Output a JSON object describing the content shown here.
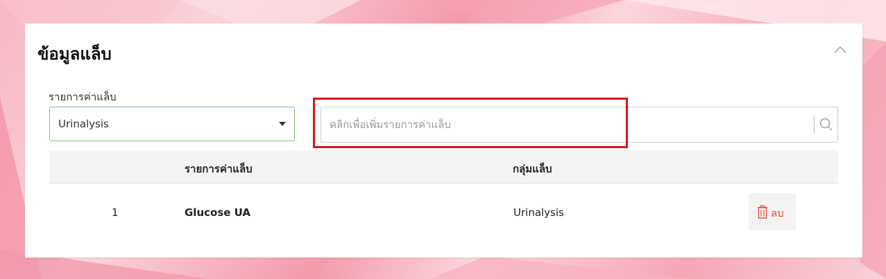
{
  "colors": {
    "accent_green": "#7dc57d",
    "highlight_red": "#e01212",
    "delete_red": "#e84c3d"
  },
  "card": {
    "title": "ข้อมูลแล็บ",
    "collapse_icon": "chevron-up-icon"
  },
  "filter": {
    "label": "รายการค่าแล็บ",
    "selected_value": "Urinalysis"
  },
  "search": {
    "placeholder": "คลิกเพื่อเพิ่มรายการค่าแล็บ",
    "value": "",
    "icon": "search-icon"
  },
  "table": {
    "headers": {
      "item": "รายการค่าแล็บ",
      "group": "กลุ่มแล็บ"
    },
    "rows": [
      {
        "index": "1",
        "item": "Glucose UA",
        "group": "Urinalysis",
        "delete_label": "ลบ"
      }
    ]
  }
}
